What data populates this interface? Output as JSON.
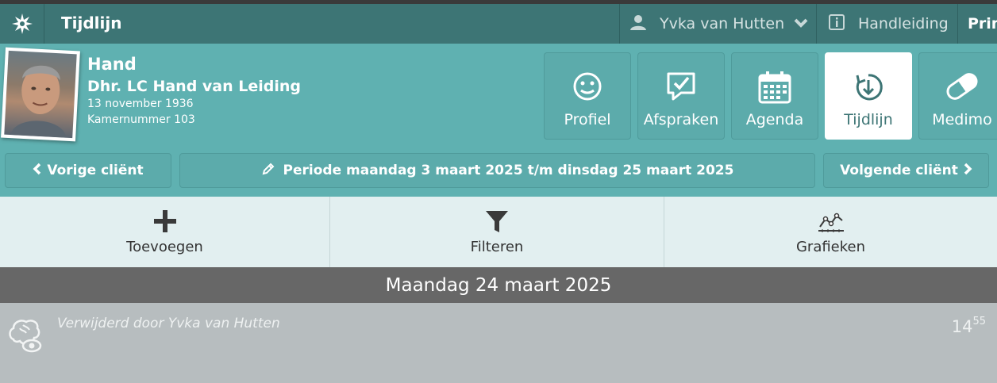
{
  "topbar": {
    "title": "Tijdlijn",
    "user_name": "Yvka van Hutten",
    "manual_label": "Handleiding",
    "print_label": "Prin"
  },
  "client": {
    "short_name": "Hand",
    "full_name": "Dhr. LC Hand van Leiding",
    "birth_date": "13 november 1936",
    "room": "Kamernummer 103"
  },
  "tiles": [
    {
      "label": "Profiel",
      "icon": "smiley-icon"
    },
    {
      "label": "Afspraken",
      "icon": "speech-check-icon"
    },
    {
      "label": "Agenda",
      "icon": "calendar-icon"
    },
    {
      "label": "Tijdlijn",
      "icon": "timeline-icon",
      "active": true
    },
    {
      "label": "Medimo",
      "icon": "pill-icon"
    }
  ],
  "nav": {
    "prev_label": "Vorige cliënt",
    "period_label": "Periode maandag 3 maart 2025 t/m dinsdag 25 maart 2025",
    "next_label": "Volgende cliënt"
  },
  "actions": {
    "add_label": "Toevoegen",
    "filter_label": "Filteren",
    "charts_label": "Grafieken"
  },
  "day": {
    "heading": "Maandag 24 maart 2025",
    "entries": [
      {
        "text": "Verwijderd door Yvka van Hutten",
        "hour": "14",
        "minute": "55"
      }
    ]
  },
  "colors": {
    "topbar": "#3d7575",
    "header": "#5fb1b1",
    "action_bar": "#e2eff0",
    "date_bar": "#676767",
    "entry_bg": "#b7bdbf"
  }
}
